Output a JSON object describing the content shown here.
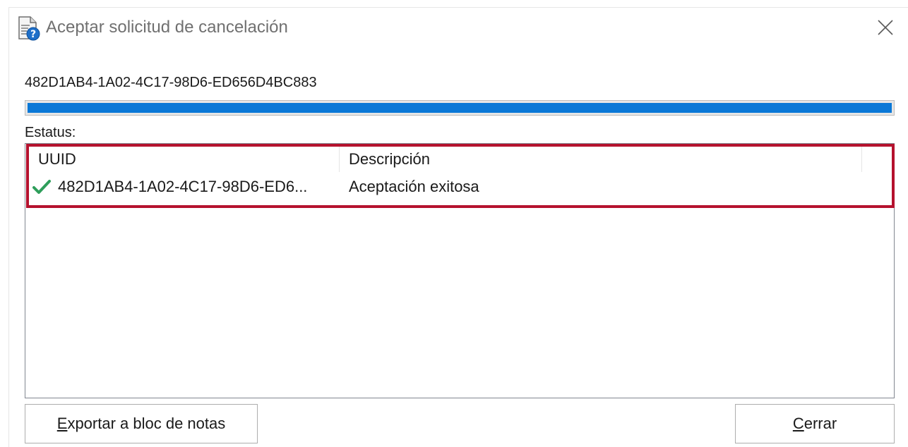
{
  "window": {
    "title": "Aceptar solicitud de cancelación"
  },
  "progress": {
    "uuid": "482D1AB4-1A02-4C17-98D6-ED656D4BC883",
    "value": 1.0,
    "color": "#0a78d7"
  },
  "status": {
    "label": "Estatus:",
    "columns": [
      "UUID",
      "Descripción"
    ],
    "rows": [
      {
        "icon": "green-check-icon",
        "uuid": "482D1AB4-1A02-4C17-98D6-ED6...",
        "description": "Aceptación exitosa"
      }
    ],
    "highlight_color": "#b5122e"
  },
  "buttons": {
    "export": {
      "mnemonic": "E",
      "rest": "xportar a bloc de notas"
    },
    "close": {
      "mnemonic": "C",
      "rest": "errar"
    }
  }
}
